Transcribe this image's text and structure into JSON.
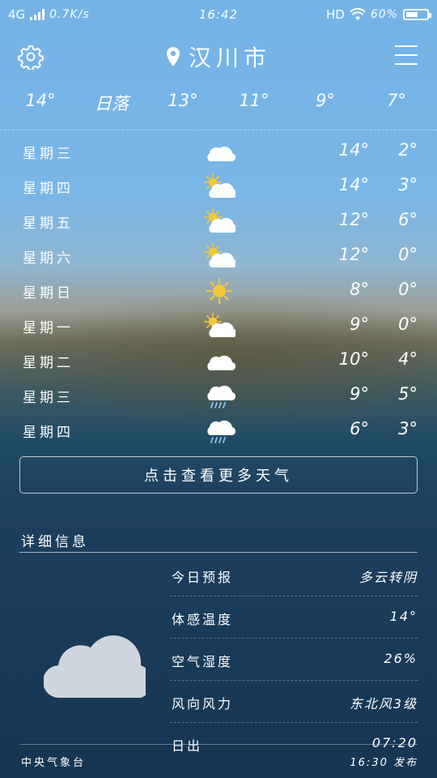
{
  "status_bar": {
    "network": "4G",
    "speed": "0.7K/s",
    "time": "16:42",
    "hd": "HD",
    "battery": "60%",
    "battery_level": 0.6
  },
  "header": {
    "city": "汉川市",
    "icons": {
      "settings": "gear-icon",
      "location": "location-pin-icon",
      "menu": "hamburger-menu-icon"
    }
  },
  "hourly": [
    "14°",
    "日落",
    "13°",
    "11°",
    "9°",
    "7°"
  ],
  "daily": [
    {
      "day": "星期三",
      "icon": "cloudy",
      "high": "14°",
      "low": "2°"
    },
    {
      "day": "星期四",
      "icon": "partly-cloudy",
      "high": "14°",
      "low": "3°"
    },
    {
      "day": "星期五",
      "icon": "partly-cloudy",
      "high": "12°",
      "low": "6°"
    },
    {
      "day": "星期六",
      "icon": "partly-cloudy",
      "high": "12°",
      "low": "0°"
    },
    {
      "day": "星期日",
      "icon": "sunny",
      "high": "8°",
      "low": "0°"
    },
    {
      "day": "星期一",
      "icon": "partly-cloudy",
      "high": "9°",
      "low": "0°"
    },
    {
      "day": "星期二",
      "icon": "cloudy",
      "high": "10°",
      "low": "4°"
    },
    {
      "day": "星期三",
      "icon": "rain",
      "high": "9°",
      "low": "5°"
    },
    {
      "day": "星期四",
      "icon": "rain",
      "high": "6°",
      "low": "3°"
    }
  ],
  "more_button": "点击查看更多天气",
  "details": {
    "title": "详细信息",
    "icon": "cloud-icon",
    "rows": [
      {
        "label": "今日预报",
        "value": "多云转阴"
      },
      {
        "label": "体感温度",
        "value": "14°"
      },
      {
        "label": "空气湿度",
        "value": "26%"
      },
      {
        "label": "风向风力",
        "value": "东北风3级"
      },
      {
        "label": "日出",
        "value": "07:20"
      }
    ]
  },
  "footer": {
    "source": "中央气象台",
    "published": "16:30 发布"
  },
  "colors": {
    "sun": "#f6c63a",
    "cloud": "#ffffff",
    "big_cloud": "#cfd5dc",
    "rain": "#8fd0ff"
  }
}
